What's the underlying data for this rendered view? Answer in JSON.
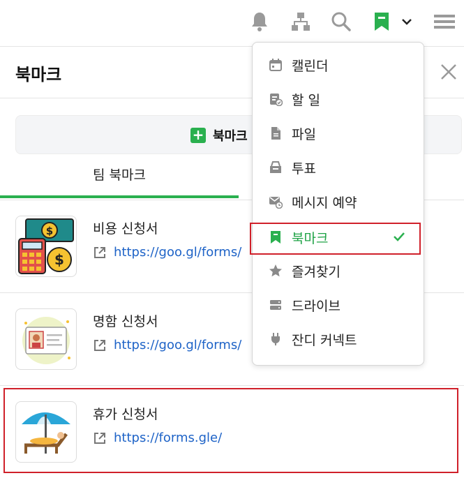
{
  "topbar": {
    "icons": [
      "bell-icon",
      "org-chart-icon",
      "search-icon",
      "bookmark-icon",
      "chevron-down-icon",
      "hamburger-menu-icon"
    ]
  },
  "panel": {
    "title": "북마크",
    "add_label": "북마크",
    "add_icon": "plus-icon",
    "tab_team": "팀 북마크"
  },
  "bookmarks": [
    {
      "title": "비용 신청서",
      "link": "https://goo.gl/forms/",
      "thumb": "expense-icon"
    },
    {
      "title": "명함 신청서",
      "link": "https://goo.gl/forms/",
      "thumb": "business-card-icon"
    },
    {
      "title": "휴가 신청서",
      "link": "https://forms.gle/",
      "thumb": "vacation-icon"
    }
  ],
  "menu": {
    "items": [
      {
        "label": "캘린더",
        "icon": "calendar-icon"
      },
      {
        "label": "할 일",
        "icon": "task-icon"
      },
      {
        "label": "파일",
        "icon": "file-icon"
      },
      {
        "label": "투표",
        "icon": "vote-icon"
      },
      {
        "label": "메시지 예약",
        "icon": "scheduled-message-icon"
      },
      {
        "label": "북마크",
        "icon": "bookmark-icon",
        "active": true
      },
      {
        "label": "즐겨찾기",
        "icon": "star-icon"
      },
      {
        "label": "드라이브",
        "icon": "drive-icon"
      },
      {
        "label": "잔디 커넥트",
        "icon": "plug-icon"
      }
    ]
  },
  "colors": {
    "accent": "#2ab04f",
    "link": "#1e63c7",
    "highlight": "#d0202a",
    "icon_gray": "#8a8a8a"
  }
}
